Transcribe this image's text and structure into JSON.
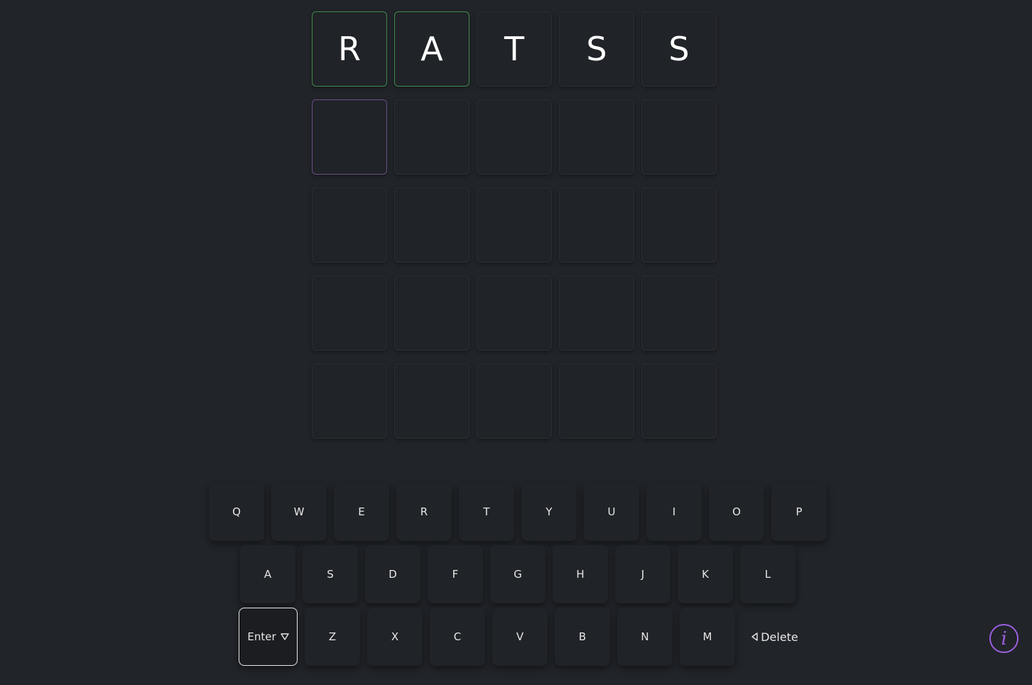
{
  "board": {
    "rows": [
      [
        {
          "letter": "R",
          "state": "correct"
        },
        {
          "letter": "A",
          "state": "correct"
        },
        {
          "letter": "T",
          "state": "filled"
        },
        {
          "letter": "S",
          "state": "filled"
        },
        {
          "letter": "S",
          "state": "filled"
        }
      ],
      [
        {
          "letter": "",
          "state": "active"
        },
        {
          "letter": "",
          "state": "empty"
        },
        {
          "letter": "",
          "state": "empty"
        },
        {
          "letter": "",
          "state": "empty"
        },
        {
          "letter": "",
          "state": "empty"
        }
      ],
      [
        {
          "letter": "",
          "state": "empty"
        },
        {
          "letter": "",
          "state": "empty"
        },
        {
          "letter": "",
          "state": "empty"
        },
        {
          "letter": "",
          "state": "empty"
        },
        {
          "letter": "",
          "state": "empty"
        }
      ],
      [
        {
          "letter": "",
          "state": "empty"
        },
        {
          "letter": "",
          "state": "empty"
        },
        {
          "letter": "",
          "state": "empty"
        },
        {
          "letter": "",
          "state": "empty"
        },
        {
          "letter": "",
          "state": "empty"
        }
      ],
      [
        {
          "letter": "",
          "state": "empty"
        },
        {
          "letter": "",
          "state": "empty"
        },
        {
          "letter": "",
          "state": "empty"
        },
        {
          "letter": "",
          "state": "empty"
        },
        {
          "letter": "",
          "state": "empty"
        }
      ]
    ]
  },
  "keyboard": {
    "row1": [
      "Q",
      "W",
      "E",
      "R",
      "T",
      "Y",
      "U",
      "I",
      "O",
      "P"
    ],
    "row2": [
      "A",
      "S",
      "D",
      "F",
      "G",
      "H",
      "J",
      "K",
      "L"
    ],
    "row3": [
      "Z",
      "X",
      "C",
      "V",
      "B",
      "N",
      "M"
    ],
    "enter_label": "Enter",
    "enter_icon": "triangle-down-icon",
    "delete_label": "Delete",
    "delete_icon": "triangle-left-icon"
  },
  "info": {
    "label": "i",
    "icon": "info-icon",
    "color": "#9b5fe0"
  },
  "colors": {
    "background": "#212429",
    "correct_border": "#3f8a4f",
    "active_border": "#6b4e8a",
    "tile_border": "#2b2e33"
  }
}
